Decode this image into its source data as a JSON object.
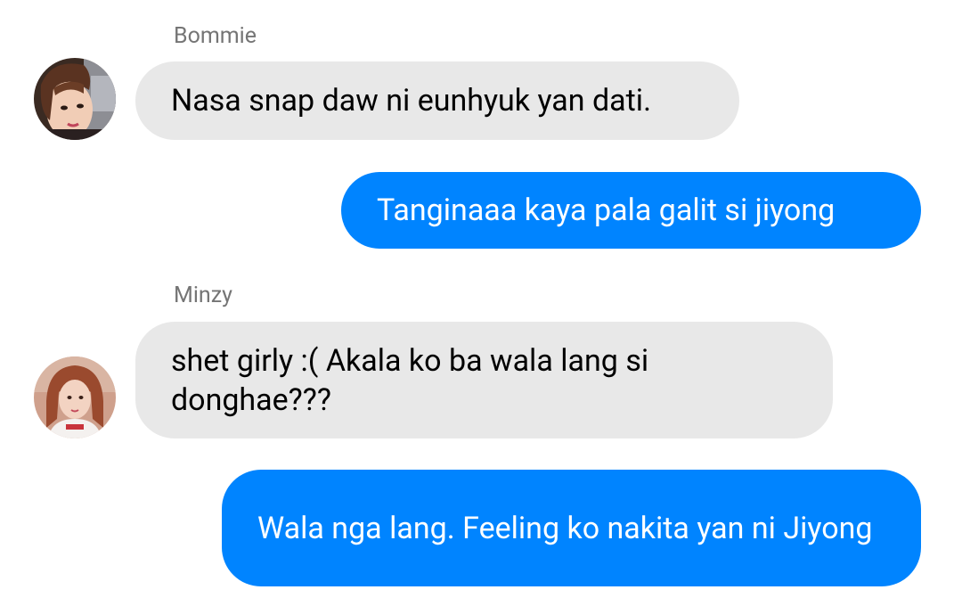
{
  "colors": {
    "outgoing_bubble": "#0084ff",
    "incoming_bubble": "#e8e8e8",
    "sender_name": "#757575"
  },
  "messages": [
    {
      "sender": "Bommie",
      "text": "Nasa snap daw ni eunhyuk yan dati.",
      "direction": "incoming",
      "avatar": "bommie-avatar"
    },
    {
      "sender": "",
      "text": "Tanginaaa kaya pala galit si jiyong",
      "direction": "outgoing"
    },
    {
      "sender": "Minzy",
      "text": "shet girly :( Akala ko ba wala lang si donghae???",
      "direction": "incoming",
      "avatar": "minzy-avatar"
    },
    {
      "sender": "",
      "text": "Wala nga lang. Feeling ko nakita yan ni Jiyong",
      "direction": "outgoing"
    }
  ]
}
